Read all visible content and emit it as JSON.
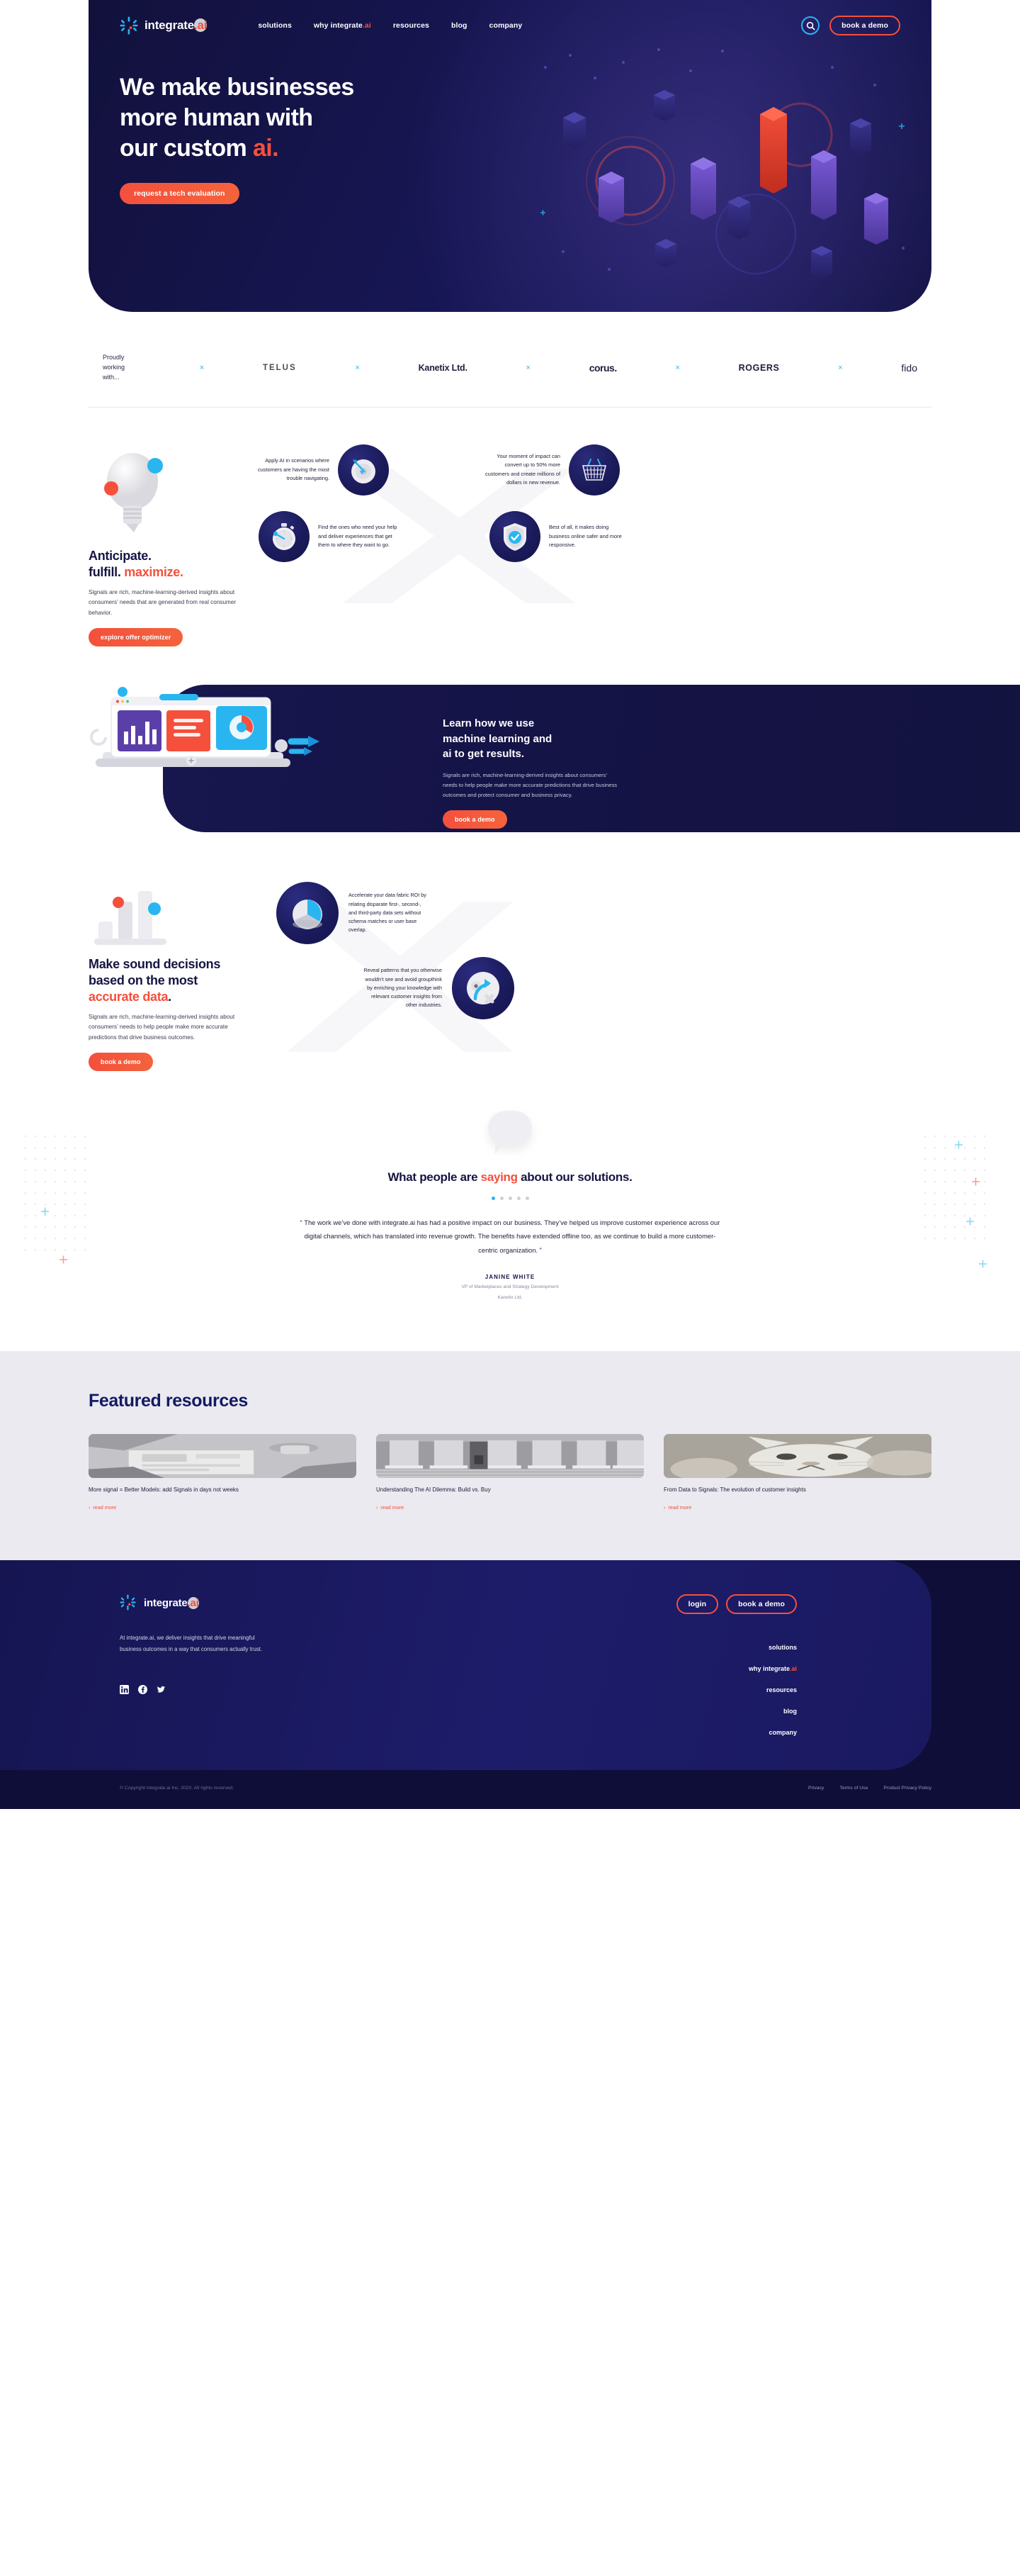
{
  "brand": {
    "name": "integrate.ai",
    "accent_orange": "#f4503c",
    "accent_blue": "#29b6f0",
    "navy": "#141344"
  },
  "nav": {
    "logo_text": "integrate",
    "logo_suffix": ".ai",
    "items": [
      {
        "label": "solutions"
      },
      {
        "label": "why integrate",
        "suffix": ".ai"
      },
      {
        "label": "resources"
      },
      {
        "label": "blog"
      },
      {
        "label": "company"
      }
    ],
    "search_icon": "search-icon",
    "cta": "book a demo"
  },
  "hero": {
    "line1": "We make businesses",
    "line2": "more human with",
    "line3_plain": "our custom ",
    "line3_accent": "ai.",
    "cta": "request a tech evaluation"
  },
  "partners": {
    "label": "Proudly working with...",
    "separator": "×",
    "logos": [
      "TELUS",
      "Kanetix Ltd.",
      "corus.",
      "ROGERS",
      "fido"
    ]
  },
  "anticipate": {
    "illustration": "lightbulb-illustration",
    "title_line1": "Anticipate.",
    "title_line2_plain": "fulfill. ",
    "title_line2_accent": "maximize.",
    "paragraph": "Signals are rich, machine-learning-derived insights about consumers’ needs that are generated from real consumer behavior.",
    "cta": "explore offer optimizer",
    "features": [
      {
        "text": "Apply AI in scenarios where customers are having the most trouble navigating.",
        "icon": "target-arrow-icon",
        "align": "right"
      },
      {
        "text": "Your moment of impact can convert up to 50% more customers and create millions of dollars in new revenue.",
        "icon": "shopping-basket-icon",
        "align": "right"
      },
      {
        "text": "Find the ones who need your help and deliver experiences that get them to where they want to go.",
        "icon": "stopwatch-icon",
        "align": "left"
      },
      {
        "text": "Best of all, it makes doing business online safer and more responsive.",
        "icon": "shield-check-icon",
        "align": "left"
      }
    ]
  },
  "ml": {
    "illustration": "laptop-dashboard-illustration",
    "title_line1": "Learn how we use",
    "title_line2": "machine learning and",
    "title_line3": "ai to get results.",
    "paragraph": "Signals are rich, machine-learning-derived insights about consumers’ needs to help people make more accurate predictions that drive business outcomes and protect consumer and business privacy.",
    "cta": "book a demo"
  },
  "sound": {
    "illustration": "bar-chart-illustration",
    "title_line1": "Make sound decisions",
    "title_line2": "based on the most",
    "title_line3_accent": "accurate data",
    "title_line3_tail": ".",
    "paragraph": "Signals are rich, machine-learning-derived insights about consumers’ needs to help people make more accurate predictions that drive business outcomes.",
    "cta": "book a demo",
    "features": [
      {
        "text": "Accelerate your data fabric ROI by relating disparate first-, second-, and third-party data sets without schema matches or user base overlap.",
        "icon": "pie-chart-icon"
      },
      {
        "text": "Reveal patterns that you otherwise wouldn’t see and avoid groupthink by enriching your knowledge with relevant customer insights from other industries.",
        "icon": "arrow-pivot-icon"
      }
    ]
  },
  "testimonial": {
    "icon": "speech-bubble-icon",
    "heading_before": "What people are ",
    "heading_accent": "saying",
    "heading_after": " about our solutions.",
    "dots_total": 5,
    "dots_active_index": 0,
    "quote": "“ The work we’ve done with integrate.ai has had a positive impact on our business. They’ve helped us improve customer experience across our digital channels, which has translated into revenue growth. The benefits have extended offline too, as we continue to build a more customer-centric organization. ”",
    "author": "JANINE WHITE",
    "role": "VP of Marketplaces and Strategy Development",
    "company": "Kanetix Ltd."
  },
  "resources": {
    "title": "Featured resources",
    "read_more_label": "read more",
    "items": [
      {
        "thumb": "team-meeting-photo",
        "title": "More signal = Better Models: add Signals in days not weeks"
      },
      {
        "thumb": "classical-columns-photo",
        "title": "Understanding The AI Dilemma: Build vs. Buy"
      },
      {
        "thumb": "cat-masks-photo",
        "title": "From Data to Signals: The evolution of customer insights"
      }
    ]
  },
  "footer": {
    "logo_text": "integrate",
    "logo_suffix": ".ai",
    "description": "At integrate.ai, we deliver insights that drive meaningful business outcomes in a way that consumers actually trust.",
    "socials": [
      "linkedin-icon",
      "facebook-icon",
      "twitter-icon"
    ],
    "login_label": "login",
    "demo_label": "book a demo",
    "links": [
      {
        "label": "solutions"
      },
      {
        "label": "why integrate",
        "suffix": ".ai"
      },
      {
        "label": "resources"
      },
      {
        "label": "blog"
      },
      {
        "label": "company"
      }
    ],
    "copyright": "© Copyright integrate.ai Inc. 2020. All rights reserved.",
    "legal": [
      "Privacy",
      "Terms of Use",
      "Product Privacy Policy"
    ]
  }
}
